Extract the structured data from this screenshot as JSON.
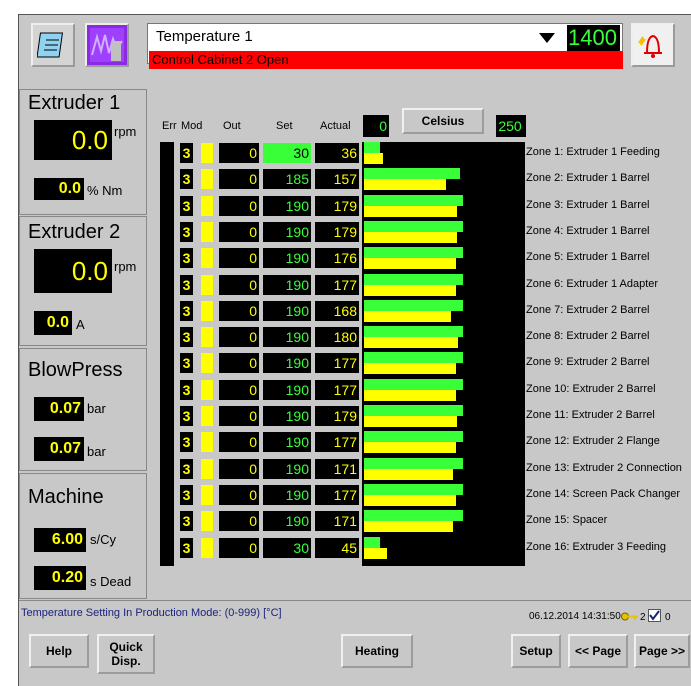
{
  "header": {
    "title": "Temperature 1",
    "alarm": "Control Cabinet 2 Open",
    "value": "1400"
  },
  "extruder1": {
    "title": "Extruder 1",
    "speed": "0.0",
    "speed_unit": "rpm",
    "torque": "0.0",
    "torque_unit": "% Nm"
  },
  "extruder2": {
    "title": "Extruder 2",
    "speed": "0.0",
    "speed_unit": "rpm",
    "current": "0.0",
    "current_unit": "A"
  },
  "blowpress": {
    "title": "BlowPress",
    "value1": "0.07",
    "unit1": "bar",
    "value2": "0.07",
    "unit2": "bar"
  },
  "machine": {
    "title": "Machine",
    "cycle": "6.00",
    "cycle_unit": "s/Cy",
    "dead": "0.20",
    "dead_unit": "s Dead"
  },
  "table": {
    "headers": {
      "err": "Err",
      "mod": "Mod",
      "out": "Out",
      "set": "Set",
      "actual": "Actual"
    },
    "range_min": "0",
    "unit_button": "Celsius",
    "range_max": "250",
    "rows": [
      {
        "mod": "3",
        "out": "0",
        "set": "30",
        "actual": "36",
        "zone": "Zone 1:  Extruder 1 Feeding"
      },
      {
        "mod": "3",
        "out": "0",
        "set": "185",
        "actual": "157",
        "zone": "Zone 2:  Extruder 1 Barrel"
      },
      {
        "mod": "3",
        "out": "0",
        "set": "190",
        "actual": "179",
        "zone": "Zone 3:  Extruder 1 Barrel"
      },
      {
        "mod": "3",
        "out": "0",
        "set": "190",
        "actual": "179",
        "zone": "Zone 4:  Extruder 1 Barrel"
      },
      {
        "mod": "3",
        "out": "0",
        "set": "190",
        "actual": "176",
        "zone": "Zone 5:  Extruder 1 Barrel"
      },
      {
        "mod": "3",
        "out": "0",
        "set": "190",
        "actual": "177",
        "zone": "Zone 6:  Extruder 1 Adapter"
      },
      {
        "mod": "3",
        "out": "0",
        "set": "190",
        "actual": "168",
        "zone": "Zone 7:  Extruder 2 Barrel"
      },
      {
        "mod": "3",
        "out": "0",
        "set": "190",
        "actual": "180",
        "zone": "Zone 8:  Extruder 2 Barrel"
      },
      {
        "mod": "3",
        "out": "0",
        "set": "190",
        "actual": "177",
        "zone": "Zone 9:  Extruder 2 Barrel"
      },
      {
        "mod": "3",
        "out": "0",
        "set": "190",
        "actual": "177",
        "zone": "Zone 10: Extruder 2 Barrel"
      },
      {
        "mod": "3",
        "out": "0",
        "set": "190",
        "actual": "179",
        "zone": "Zone 11: Extruder 2 Barrel"
      },
      {
        "mod": "3",
        "out": "0",
        "set": "190",
        "actual": "177",
        "zone": "Zone 12: Extruder 2 Flange"
      },
      {
        "mod": "3",
        "out": "0",
        "set": "190",
        "actual": "171",
        "zone": "Zone 13: Extruder 2 Connection"
      },
      {
        "mod": "3",
        "out": "0",
        "set": "190",
        "actual": "177",
        "zone": "Zone 14: Screen Pack Changer"
      },
      {
        "mod": "3",
        "out": "0",
        "set": "190",
        "actual": "171",
        "zone": "Zone 15: Spacer"
      },
      {
        "mod": "3",
        "out": "0",
        "set": "30",
        "actual": "45",
        "zone": "Zone 16: Extruder 3 Feeding"
      }
    ]
  },
  "status": {
    "message": "Temperature Setting In Production Mode: (0-999) [°C]",
    "datetime": "06.12.2014 14:31:50",
    "key_count": "2",
    "check_count": "0"
  },
  "buttons": {
    "help": "Help",
    "quick_disp": "Quick Disp.",
    "heating": "Heating",
    "setup": "Setup",
    "prev_page": "<< Page",
    "next_page": "Page >>"
  },
  "colors": {
    "green": "#39ff39",
    "yellow": "#ffff00",
    "alarm": "#ff0000",
    "blue": "#1a237e"
  }
}
